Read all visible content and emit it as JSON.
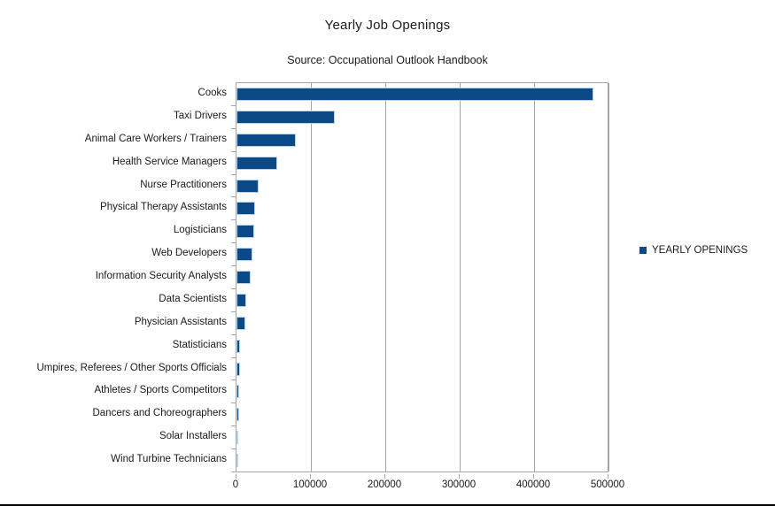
{
  "chart_data": {
    "type": "bar",
    "orientation": "horizontal",
    "title": "Yearly Job Openings",
    "subtitle": "Source: Occupational Outlook Handbook",
    "xlabel": "",
    "ylabel": "",
    "xlim": [
      0,
      500000
    ],
    "xticks": [
      "0",
      "100000",
      "200000",
      "300000",
      "400000",
      "500000"
    ],
    "xtick_values": [
      0,
      100000,
      200000,
      300000,
      400000,
      500000
    ],
    "grid": true,
    "legend_position": "right",
    "series_name": "YEARLY OPENINGS",
    "series_color": "#0B4A87",
    "categories": [
      "Cooks",
      "Taxi Drivers",
      "Animal Care Workers / Trainers",
      "Health Service Managers",
      "Nurse Practitioners",
      "Physical Therapy Assistants",
      "Logisticians",
      "Web Developers",
      "Information Security Analysts",
      "Data Scientists",
      "Physician Assistants",
      "Statisticians",
      "Umpires, Referees / Other Sports Officials",
      "Athletes / Sports Competitors",
      "Dancers and Choreographers",
      "Solar Installers",
      "Wind Turbine Technicians"
    ],
    "values": [
      480000,
      132000,
      80000,
      55000,
      30000,
      25000,
      24000,
      21500,
      19500,
      13500,
      12000,
      4500,
      4500,
      3500,
      3000,
      2500,
      1800
    ],
    "series": [
      {
        "name": "YEARLY OPENINGS",
        "color": "#0B4A87",
        "values": [
          480000,
          132000,
          80000,
          55000,
          30000,
          25000,
          24000,
          21500,
          19500,
          13500,
          12000,
          4500,
          4500,
          3500,
          3000,
          2500,
          1800
        ]
      }
    ]
  },
  "legend": {
    "label": "YEARLY OPENINGS"
  },
  "colors": {
    "bar_fill": "#0B4A87",
    "bar_edge": "#bcd4ea",
    "grid": "#a6a6a6",
    "text": "#1a1a1a",
    "border": "#000000"
  }
}
